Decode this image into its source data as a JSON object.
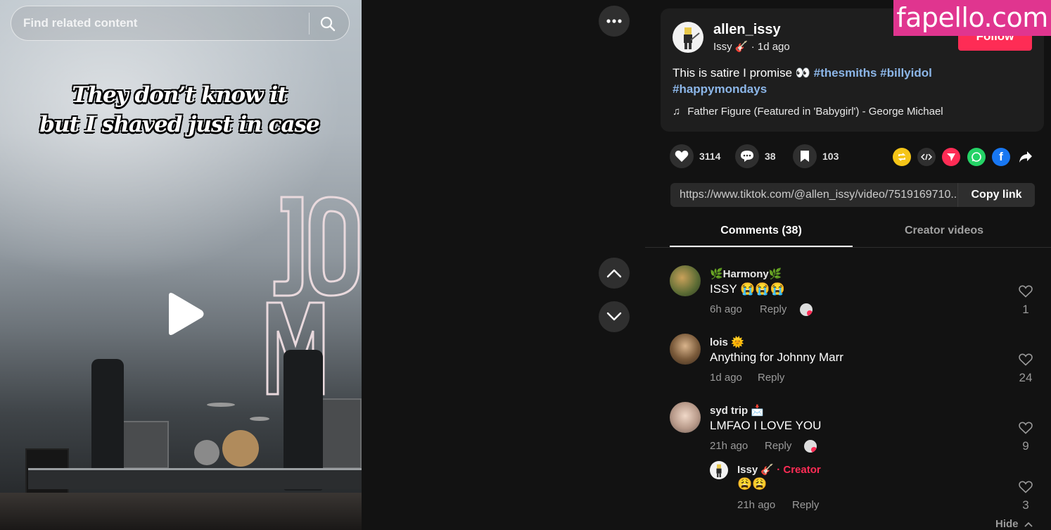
{
  "search": {
    "placeholder": "Find related content"
  },
  "video": {
    "caption_line1": "They don’t know it",
    "caption_line2": "but I shaved just in case"
  },
  "author": {
    "username": "allen_issy",
    "display_name": "Issy 🎸",
    "time": "1d ago",
    "follow_label": "Follow"
  },
  "post": {
    "text": "This is satire I promise 👀",
    "tags": [
      "#thesmiths",
      "#billyidol",
      "#happymondays"
    ],
    "music": "Father Figure (Featured in 'Babygirl') - George Michael"
  },
  "stats": {
    "likes": "3114",
    "comments": "38",
    "saves": "103"
  },
  "share_icons": [
    "repost-icon",
    "embed-icon",
    "send-icon",
    "whatsapp-icon",
    "facebook-icon",
    "share-arrow-icon"
  ],
  "link": {
    "url": "https://www.tiktok.com/@allen_issy/video/7519169710...",
    "copy_label": "Copy link"
  },
  "tabs": {
    "comments": "Comments (38)",
    "creator_videos": "Creator videos"
  },
  "comments": [
    {
      "name": "🌿Harmony🌿",
      "text": "ISSY 😭😭😭",
      "time": "6h ago",
      "reply": "Reply",
      "likes": "1"
    },
    {
      "name": "lois 🌞",
      "text": "Anything for Johnny Marr",
      "time": "1d ago",
      "reply": "Reply",
      "likes": "24"
    },
    {
      "name": "syd trip 📩",
      "text": "LMFAO I LOVE YOU",
      "time": "21h ago",
      "reply": "Reply",
      "likes": "9"
    }
  ],
  "reply": {
    "name": "Issy 🎸",
    "dot": "·",
    "badge": "Creator",
    "text": "😩😩",
    "time": "21h ago",
    "reply": "Reply",
    "likes": "3"
  },
  "hide_label": "Hide",
  "watermark": "fapello.com",
  "colors": {
    "accent": "#fe2c55",
    "hashtag": "#8cb6e8",
    "panel_bg": "#121212",
    "watermark": "#e0358f"
  }
}
